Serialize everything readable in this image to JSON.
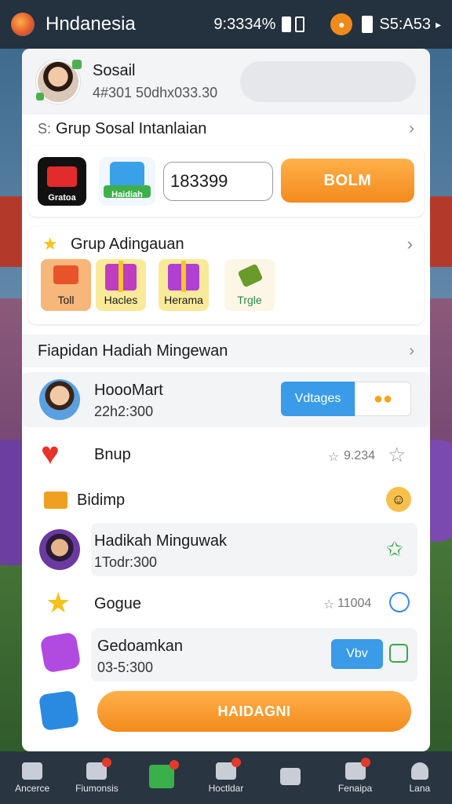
{
  "statusbar": {
    "title": "Hndanesia",
    "time_left": "9:3334%",
    "time_right": "S5:A53"
  },
  "profile": {
    "name": "Sosail",
    "sub": "4#301 50dhx033.30"
  },
  "links": {
    "group_social": "Grup Sosal Intanlaian",
    "weekly_rewards": "Fiapidan Hadiah Mingewan"
  },
  "group_card": {
    "icon1_label": "Gratoa",
    "icon2_label": "Haidiah",
    "input_value": "183399",
    "button_label": "BOLM"
  },
  "adventure_card": {
    "title": "Grup Adingauan",
    "gifts": [
      {
        "label": "Toll"
      },
      {
        "label": "Hacles"
      },
      {
        "label": "Herama"
      },
      {
        "label": "Trgle"
      }
    ]
  },
  "list": {
    "item1": {
      "title": "HoooMart",
      "sub": "22h2:300",
      "button": "Vdtages"
    },
    "item2": {
      "title": "Bnup",
      "count": "9.234"
    },
    "item3": {
      "title": "Bidimp"
    },
    "item4": {
      "title": "Hadikah Minguwak",
      "sub": "1Todr:300"
    },
    "item5": {
      "title": "Gogue",
      "count": "11004"
    },
    "item6": {
      "title": "Gedoamkan",
      "sub": "03-5:300",
      "button": "Vbv"
    }
  },
  "main_button": "HAIDAGNI",
  "tabs": [
    {
      "label": "Ancerce"
    },
    {
      "label": "Fiumonsis"
    },
    {
      "label": ""
    },
    {
      "label": "Hoctldar"
    },
    {
      "label": ""
    },
    {
      "label": "Fenaipa"
    },
    {
      "label": "Lana"
    }
  ]
}
